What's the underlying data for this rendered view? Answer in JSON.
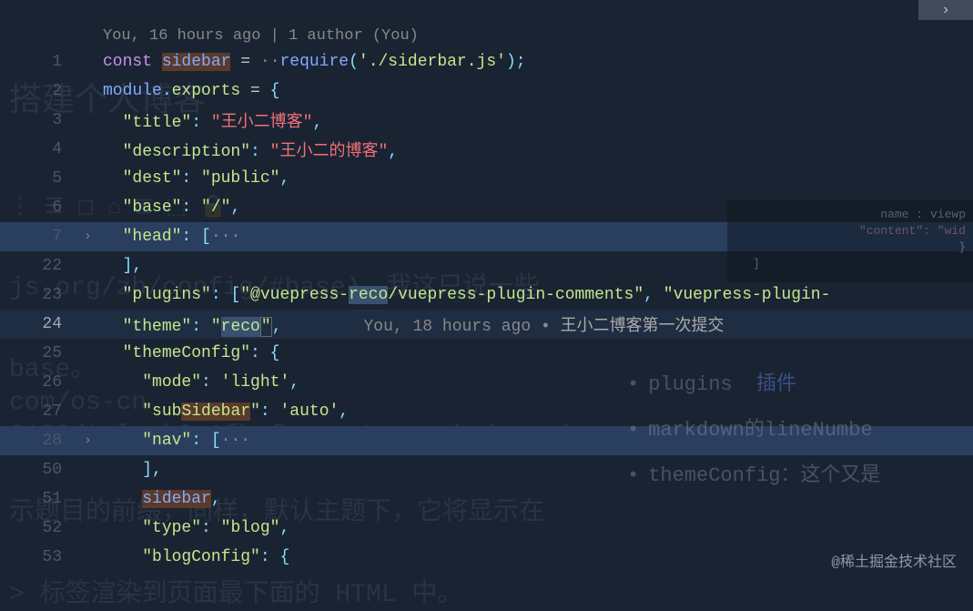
{
  "codelens": "You, 16 hours ago | 1 author (You)",
  "lines": [
    {
      "num": 1
    },
    {
      "num": 2
    },
    {
      "num": 3
    },
    {
      "num": 4
    },
    {
      "num": 5
    },
    {
      "num": 6
    },
    {
      "num": 7,
      "fold": true,
      "highlight": true
    },
    {
      "num": 22
    },
    {
      "num": 23
    },
    {
      "num": 24,
      "current": true
    },
    {
      "num": 25
    },
    {
      "num": 26
    },
    {
      "num": 27
    },
    {
      "num": 28,
      "fold": true,
      "highlight": true
    },
    {
      "num": 50
    },
    {
      "num": 51
    },
    {
      "num": 52
    },
    {
      "num": 53
    }
  ],
  "tokens": {
    "const": "const",
    "sidebar": "sidebar",
    "eq": " = ",
    "require": "require",
    "lparen": "(",
    "rparen": ")",
    "siderbarPath": "'./siderbar.js'",
    "semi": ";",
    "module": "module",
    "dot": ".",
    "exports": "exports",
    "lbrace": "{",
    "rbrace": "}",
    "lbracket": "[",
    "rbracket": "]",
    "comma": ",",
    "colon": ": ",
    "title": "\"title\"",
    "titleVal": "\"王小二博客\"",
    "description": "\"description\"",
    "descriptionVal": "\"王小二的博客\"",
    "dest": "\"dest\"",
    "destVal": "\"public\"",
    "base": "\"base\"",
    "baseVal": "\"/\"",
    "head": "\"head\"",
    "ellipsis": "···",
    "plugins": "\"plugins\"",
    "plugin1a": "\"@vuepress-",
    "plugin1b": "reco",
    "plugin1c": "/vuepress-plugin-comments\"",
    "plugin2": "\"vuepress-plugin-",
    "theme": "\"theme\"",
    "themeValA": "\"",
    "themeValB": "reco",
    "themeValC": "\"",
    "themeConfig": "\"themeConfig\"",
    "mode": "\"mode\"",
    "modeVal": "'light'",
    "subA": "\"sub",
    "subB": "Sidebar",
    "subC": "\"",
    "subVal": "'auto'",
    "nav": "\"nav\"",
    "type": "\"type\"",
    "typeVal": "\"blog\"",
    "blogConfig": "\"blogConfig\""
  },
  "blame": {
    "author": "You, 18 hours ago",
    "sep": " • ",
    "message": "王小二博客第一次提交"
  },
  "overlay": {
    "title": "搭建个人博客",
    "line1": "js.org/zh/config/#base)，我这只说一些",
    "line2": "base。",
    "line3": "com/os-cn",
    "line4": "6130/tplv-k3u1fbpfcp-watermark.image)",
    "line5": "示题目的前缀，同样，默认主题下，它将显示在",
    "line6": "> 标签渲染到页面最下面的 HTML 中。"
  },
  "side": {
    "t1": "plugins",
    "t1link": "插件",
    "t2": "markdown的lineNumbe",
    "t3": "themeConfig：这个又是"
  },
  "watermark": "@稀土掘金技术社区"
}
